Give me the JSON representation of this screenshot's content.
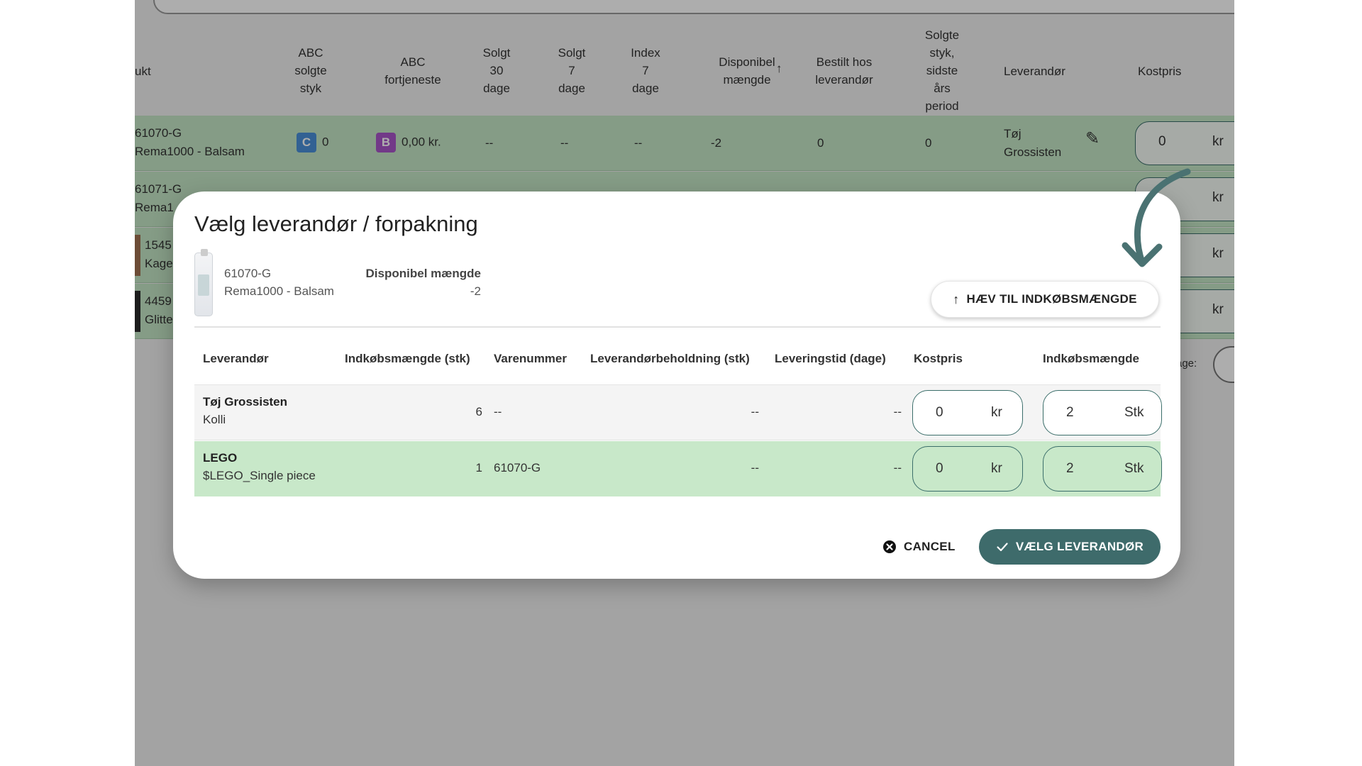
{
  "background": {
    "columns": [
      "ABC\nsolgte\nstyk",
      "ABC\nfortjeneste",
      "Solgt\n30\ndage",
      "Solgt\n7\ndage",
      "Index\n7\ndage",
      "Disponibel\nmængde",
      "Bestilt hos\nleverandør",
      "Solgte\nstyk,\nsidste\nårs\nperiod",
      "Leverandør",
      "Kostpris"
    ],
    "product_col_fragment": "ukt",
    "rows": [
      {
        "sku": "61070-G",
        "name": "Rema1000 - Balsam",
        "abc_qty_badge": "C",
        "abc_qty": "0",
        "abc_profit_badge": "B",
        "abc_profit": "0,00 kr.",
        "s30": "--",
        "s7": "--",
        "idx7": "--",
        "disp": "-2",
        "ordered": "0",
        "last_year": "0",
        "supplier": "Tøj\nGrossisten",
        "cost": "0",
        "cost_unit": "kr"
      },
      {
        "sku": "61071-G",
        "name": "Rema1",
        "cost_unit": "kr"
      },
      {
        "sku": "1545",
        "name": "Kage",
        "cost_unit": "kr"
      },
      {
        "sku": "4459",
        "name": "Glitte",
        "cost_unit": "kr"
      }
    ],
    "pager_label": "age:",
    "colors": {
      "badge_c": "#4a90d9",
      "badge_b": "#a855c9",
      "row_bg": "#c4e6c6"
    }
  },
  "dialog": {
    "title": "Vælg leverandør / forpakning",
    "product": {
      "sku": "61070-G",
      "name": "Rema1000 - Balsam"
    },
    "disponibel_label": "Disponibel mængde",
    "disponibel_value": "-2",
    "raise_button": "HÆV TIL INDKØBSMÆNGDE",
    "columns": [
      "Leverandør",
      "Indkøbsmængde (stk)",
      "Varenummer",
      "Leverandørbeholdning (stk)",
      "Leveringstid (dage)",
      "Kostpris",
      "Indkøbsmængde"
    ],
    "rows": [
      {
        "supplier": "Tøj Grossisten",
        "package": "Kolli",
        "purchase_qty": "6",
        "item_no": "--",
        "stock": "--",
        "lead_time": "--",
        "cost": "0",
        "cost_unit": "kr",
        "qty": "2",
        "qty_unit": "Stk"
      },
      {
        "supplier": "LEGO",
        "package": "$LEGO_Single piece",
        "purchase_qty": "1",
        "item_no": "61070-G",
        "stock": "--",
        "lead_time": "--",
        "cost": "0",
        "cost_unit": "kr",
        "qty": "2",
        "qty_unit": "Stk"
      }
    ],
    "cancel_button": "CANCEL",
    "choose_button": "VÆLG LEVERANDØR",
    "colors": {
      "primary": "#3e6b6b",
      "selected_row": "#c8e8c9",
      "arrow": "#4a7272"
    }
  }
}
